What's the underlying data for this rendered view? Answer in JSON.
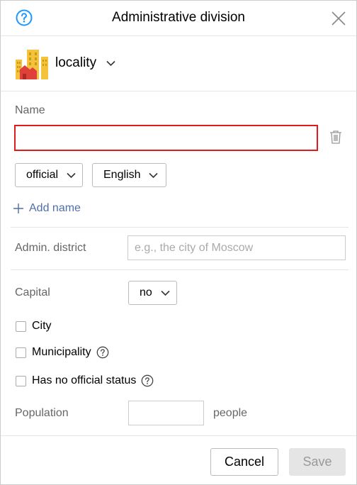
{
  "header": {
    "title": "Administrative division",
    "help_icon": "question-circle-icon",
    "close_icon": "close-icon"
  },
  "object_type": {
    "label": "locality",
    "icon": "city-buildings-icon"
  },
  "name_section": {
    "label": "Name",
    "value": "",
    "status_option": "official",
    "language_option": "English",
    "add_name_label": "Add name"
  },
  "admin_district": {
    "label": "Admin. district",
    "placeholder": "e.g., the city of Moscow",
    "value": ""
  },
  "capital": {
    "label": "Capital",
    "value": "no"
  },
  "checkboxes": [
    {
      "label": "City",
      "checked": false,
      "has_help": false
    },
    {
      "label": "Municipality",
      "checked": false,
      "has_help": true
    },
    {
      "label": "Has no official status",
      "checked": false,
      "has_help": true
    }
  ],
  "population": {
    "label": "Population",
    "value": "",
    "unit": "people"
  },
  "footer": {
    "cancel_label": "Cancel",
    "save_label": "Save"
  },
  "colors": {
    "accent": "#1e98ff",
    "error_border": "#e31a1a",
    "link": "#4e6fa8",
    "disabled_bg": "#e5e5e5"
  }
}
